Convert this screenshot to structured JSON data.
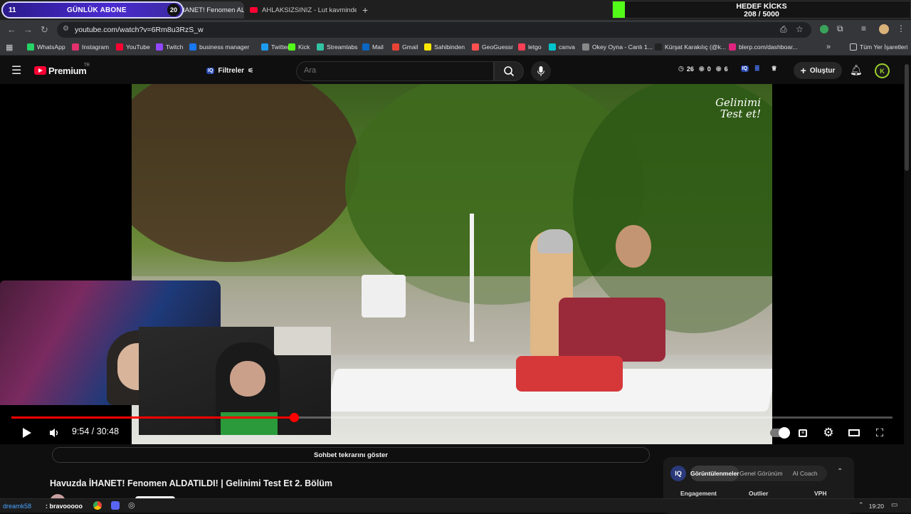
{
  "browser": {
    "tabs": [
      {
        "label": "Havuzda İHANET! Fenomen ALDATILDI!",
        "active": true
      },
      {
        "label": "AHLAKSIZSINIZ - Lut kavminde",
        "active": false
      }
    ],
    "new_tab": "+",
    "url": "youtube.com/watch?v=6Rm8u3RzS_w",
    "bookmarks": [
      {
        "label": "WhatsApp",
        "color": "#25d366"
      },
      {
        "label": "Instagram",
        "color": "#e1306c"
      },
      {
        "label": "YouTube",
        "color": "#ff0033"
      },
      {
        "label": "Twitch",
        "color": "#9146ff"
      },
      {
        "label": "business manager",
        "color": "#1877f2"
      },
      {
        "label": "Twitter",
        "color": "#1d9bf0"
      },
      {
        "label": "Kick",
        "color": "#53fc18"
      },
      {
        "label": "Streamlabs",
        "color": "#31c3a2"
      },
      {
        "label": "Mail",
        "color": "#0a66c2"
      },
      {
        "label": "Gmail",
        "color": "#ea4335"
      },
      {
        "label": "Sahibinden",
        "color": "#ffe800"
      },
      {
        "label": "GeoGuessr",
        "color": "#ff4f4f"
      },
      {
        "label": "letgo",
        "color": "#ff3f55"
      },
      {
        "label": "canva",
        "color": "#00c4cc"
      },
      {
        "label": "Okey Oyna - Canlı 1...",
        "color": "#888888"
      },
      {
        "label": "Kürşat Karakılıç (@k...",
        "color": "#222222"
      },
      {
        "label": "blerp.com/dashboar...",
        "color": "#e0237d"
      }
    ],
    "all_bookmarks": "Tüm Yer İşaretleri"
  },
  "overlay": {
    "sub_count": "11",
    "sub_label": "GÜNLÜK ABONE",
    "sub_goal": "20",
    "kick_title": "HEDEF KİCKS",
    "kick_value": "208 / 5000",
    "kick_fraction": 0.0416
  },
  "youtube": {
    "logo": "Premium",
    "region": "TR",
    "filters": "Filtreler",
    "search_placeholder": "Ara",
    "stats": [
      "26",
      "0",
      "6"
    ],
    "create": "Oluştur",
    "avatar": "K"
  },
  "player": {
    "current_time": "9:54",
    "duration": "30:48",
    "timecode": "9:54 / 30:48",
    "progress": 0.321,
    "watermark_line1": "Gelinimi",
    "watermark_line2": "Test et!"
  },
  "video": {
    "chat_replay": "Sohbet tekrarını göster",
    "title": "Havuzda İHANET! Fenomen ALDATILDI! | Gelinimi Test Et 2. Bölüm"
  },
  "vidiq": {
    "logo": "IQ",
    "tabs": [
      "Görüntülenmeler",
      "Genel Görünüm",
      "AI Coach"
    ],
    "columns": [
      "Engagement",
      "Outlier",
      "VPH"
    ]
  },
  "taskbar": {
    "user": "dreamk58",
    "message": ": bravooooo",
    "time": "19:20"
  }
}
